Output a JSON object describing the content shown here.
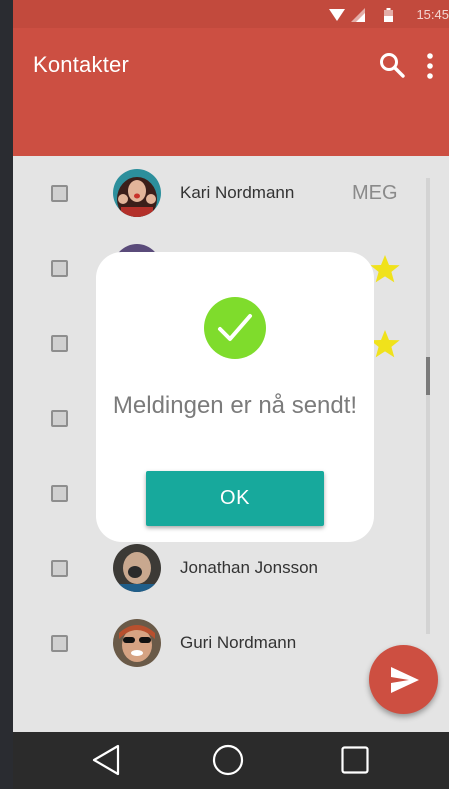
{
  "status_bar": {
    "time": "15:45"
  },
  "app_bar": {
    "title": "Kontakter",
    "search_icon": "search-icon",
    "more_icon": "more-vert-icon"
  },
  "contacts": [
    {
      "name": "Kari Nordmann",
      "badge": "MEG",
      "starred": false,
      "checked": false
    },
    {
      "name": "",
      "badge": "",
      "starred": true,
      "checked": false
    },
    {
      "name": "",
      "badge": "",
      "starred": true,
      "checked": false
    },
    {
      "name": "",
      "badge": "",
      "starred": false,
      "checked": false
    },
    {
      "name": "",
      "badge": "",
      "starred": false,
      "checked": false
    },
    {
      "name": "Jonathan Jonsson",
      "badge": "",
      "starred": false,
      "checked": false
    },
    {
      "name": "Guri Nordmann",
      "badge": "",
      "starred": false,
      "checked": false
    }
  ],
  "dialog": {
    "message": "Meldingen er nå sendt!",
    "ok_label": "OK",
    "icon": "check-circle-icon"
  },
  "fab": {
    "icon": "send-icon"
  },
  "nav_bar": {
    "back_icon": "back-icon",
    "home_icon": "home-icon",
    "recent_icon": "recent-apps-icon"
  },
  "colors": {
    "primary": "#cc4f42",
    "accent": "#17a99c",
    "success": "#7fdc2c",
    "star": "#f0e21b"
  }
}
